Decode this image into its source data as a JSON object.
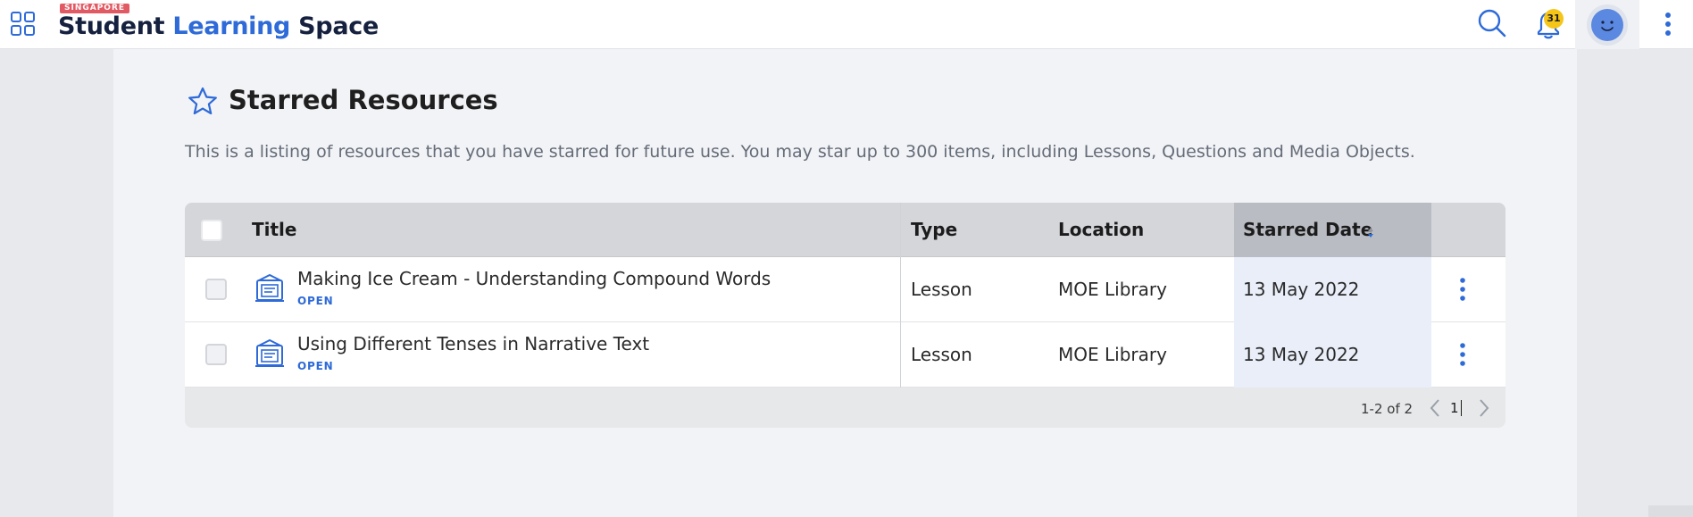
{
  "header": {
    "region_badge": "SINGAPORE",
    "logo_word_1": "Student",
    "logo_word_2": "Learning",
    "logo_word_3": "Space",
    "notification_count": "31",
    "icons": {
      "apps": "grid-icon",
      "search": "search-icon",
      "notifications": "bell-icon",
      "profile": "avatar",
      "more": "kebab-icon"
    }
  },
  "page": {
    "title": "Starred Resources",
    "description": "This is a listing of resources that you have starred for future use. You may star up to 300 items, including Lessons, Questions and Media Objects.",
    "title_icon": "star-icon"
  },
  "table": {
    "columns": {
      "title": "Title",
      "type": "Type",
      "location": "Location",
      "starred_date": "Starred Date"
    },
    "sort": {
      "column": "Starred Date",
      "direction": "descending"
    },
    "rows": [
      {
        "title": "Making Ice Cream - Understanding Compound Words",
        "action": "OPEN",
        "type": "Lesson",
        "location": "MOE Library",
        "starred_date": "13 May 2022",
        "icon": "lesson-icon"
      },
      {
        "title": "Using Different Tenses in Narrative Text",
        "action": "OPEN",
        "type": "Lesson",
        "location": "MOE Library",
        "starred_date": "13 May 2022",
        "icon": "lesson-icon"
      }
    ],
    "pagination": {
      "range_text": "1-2 of 2",
      "current_page": "1"
    }
  },
  "colors": {
    "accent": "#2e6ad8",
    "brand_dark": "#15213f",
    "badge_red": "#e15a63",
    "notification_badge": "#f5c518",
    "header_bg": "#d4d6da",
    "sorted_header_bg": "#b9bcc2",
    "sorted_cell_bg": "#e9eef9"
  }
}
